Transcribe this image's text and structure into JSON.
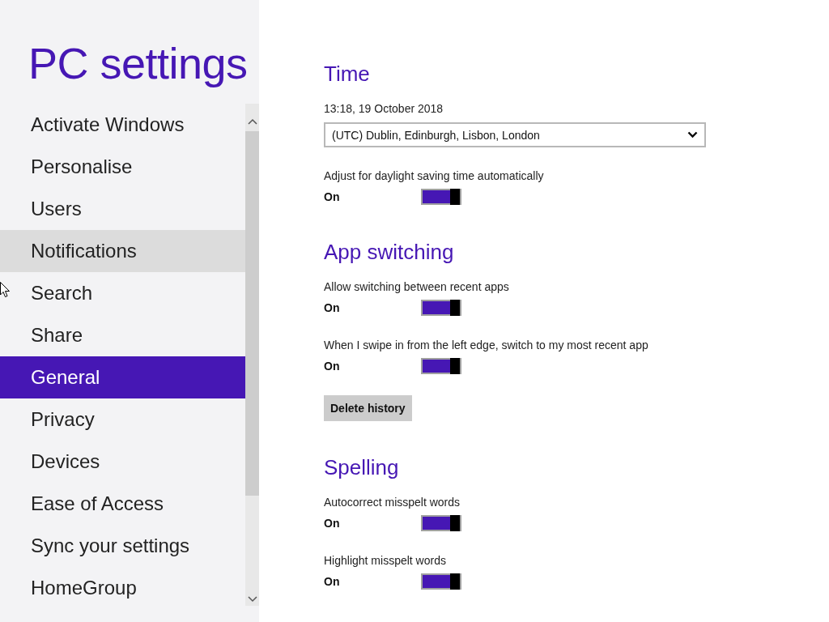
{
  "sidebar": {
    "title": "PC settings",
    "items": [
      {
        "label": "Activate Windows",
        "selected": false,
        "hovered": false
      },
      {
        "label": "Personalise",
        "selected": false,
        "hovered": false
      },
      {
        "label": "Users",
        "selected": false,
        "hovered": false
      },
      {
        "label": "Notifications",
        "selected": false,
        "hovered": true
      },
      {
        "label": "Search",
        "selected": false,
        "hovered": false
      },
      {
        "label": "Share",
        "selected": false,
        "hovered": false
      },
      {
        "label": "General",
        "selected": true,
        "hovered": false
      },
      {
        "label": "Privacy",
        "selected": false,
        "hovered": false
      },
      {
        "label": "Devices",
        "selected": false,
        "hovered": false
      },
      {
        "label": "Ease of Access",
        "selected": false,
        "hovered": false
      },
      {
        "label": "Sync your settings",
        "selected": false,
        "hovered": false
      },
      {
        "label": "HomeGroup",
        "selected": false,
        "hovered": false
      }
    ]
  },
  "sections": [
    {
      "title": "Time",
      "items": [
        {
          "kind": "text",
          "text": "13:18, 19 October 2018"
        },
        {
          "kind": "dropdown",
          "value": "(UTC) Dublin, Edinburgh, Lisbon, London"
        },
        {
          "kind": "toggle",
          "label": "Adjust for daylight saving time automatically",
          "state": "On",
          "on": true
        }
      ]
    },
    {
      "title": "App switching",
      "items": [
        {
          "kind": "toggle",
          "label": "Allow switching between recent apps",
          "state": "On",
          "on": true
        },
        {
          "kind": "toggle",
          "label": "When I swipe in from the left edge, switch to my most recent app",
          "state": "On",
          "on": true
        },
        {
          "kind": "button",
          "label": "Delete history"
        }
      ]
    },
    {
      "title": "Spelling",
      "items": [
        {
          "kind": "toggle",
          "label": "Autocorrect misspelt words",
          "state": "On",
          "on": true
        },
        {
          "kind": "toggle",
          "label": "Highlight misspelt words",
          "state": "On",
          "on": true
        }
      ]
    }
  ]
}
